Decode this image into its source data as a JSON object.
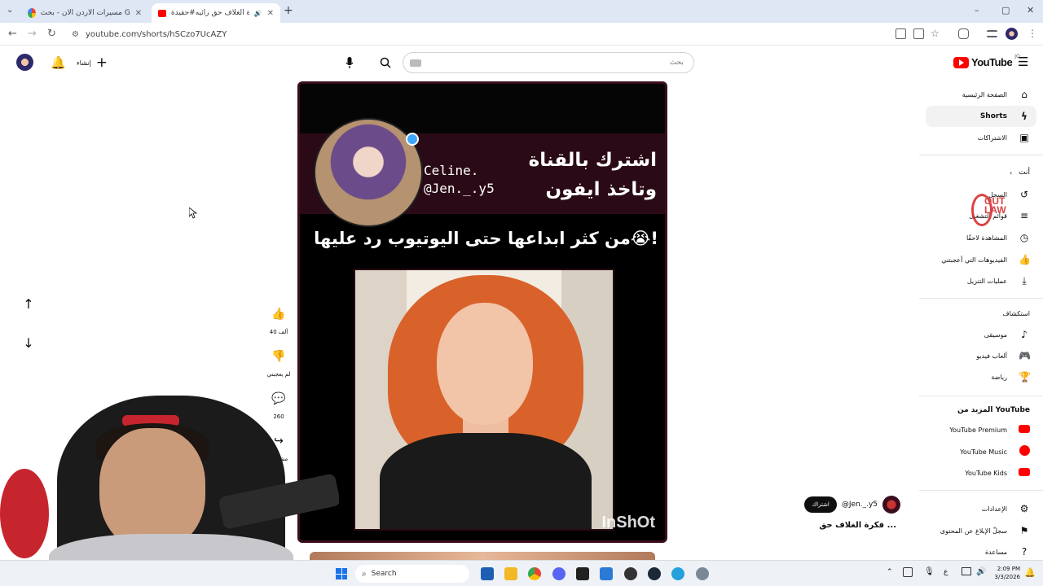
{
  "browser": {
    "tabs": [
      {
        "label": "مسيرات الاردن الان - بحث Google",
        "close": "✕"
      },
      {
        "label": "فكرة الغلاف حق رائيه#حقيدة_",
        "close": "✕"
      }
    ],
    "new_tab": "+",
    "url": "youtube.com/shorts/hSCzo7UcAZY",
    "window_controls": [
      "–",
      "▢",
      "✕"
    ]
  },
  "youtube": {
    "logo_text": "YouTube",
    "logo_region": "JO",
    "search_placeholder": "بحث",
    "create_label": "إنشاء",
    "sidebar": {
      "items": [
        {
          "label": "الصفحة الرئيسية",
          "icon": "home-icon"
        },
        {
          "label": "Shorts",
          "icon": "shorts-icon",
          "active": true
        },
        {
          "label": "الاشتراكات",
          "icon": "subscriptions-icon"
        }
      ],
      "you_header": "أنت",
      "you_items": [
        {
          "label": "السجل",
          "icon": "history-icon"
        },
        {
          "label": "قوائم التشغيل",
          "icon": "playlists-icon"
        },
        {
          "label": "المشاهدة لاحقًا",
          "icon": "watch-later-icon"
        },
        {
          "label": "الفيديوهات التي أعجبتني",
          "icon": "liked-icon"
        },
        {
          "label": "عمليات التنزيل",
          "icon": "download-icon"
        }
      ],
      "explore_header": "استكشاف",
      "explore_items": [
        {
          "label": "موسيقى",
          "icon": "music-icon"
        },
        {
          "label": "ألعاب فيديو",
          "icon": "gaming-icon"
        },
        {
          "label": "رياضة",
          "icon": "trophy-icon"
        }
      ],
      "more_header": "المزيد من YouTube",
      "more_items": [
        {
          "label": "YouTube Premium"
        },
        {
          "label": "YouTube Music"
        },
        {
          "label": "YouTube Kids"
        }
      ],
      "settings_items": [
        {
          "label": "الإعدادات",
          "icon": "settings-icon"
        },
        {
          "label": "سجلّ الإبلاغ عن المحتوى",
          "icon": "flag-icon"
        },
        {
          "label": "مساعدة",
          "icon": "help-icon"
        }
      ]
    },
    "short": {
      "channel_handle_overlay": "Celine.\n@Jen._.y5",
      "ad_text": "اشترك بالقناة\nوتاخذ ايفون",
      "headline": "من كثر ابداعها حتى اليوتيوب رد عليها😭!",
      "watermark": "InShOt",
      "like_count": "40 ألف",
      "dislike_label": "لم يعجبني",
      "comment_count": "260",
      "share_label": "مشاركة",
      "channel_name": "@Jen._.y5",
      "subscribe_label": "اشتراك",
      "title": "فكرة الغلاف حق ..."
    },
    "overlay_logo": "OUT LAW"
  },
  "taskbar": {
    "search_label": "Search",
    "time": "2:09 PM",
    "date": "3/3/2026",
    "lang": "ع"
  }
}
